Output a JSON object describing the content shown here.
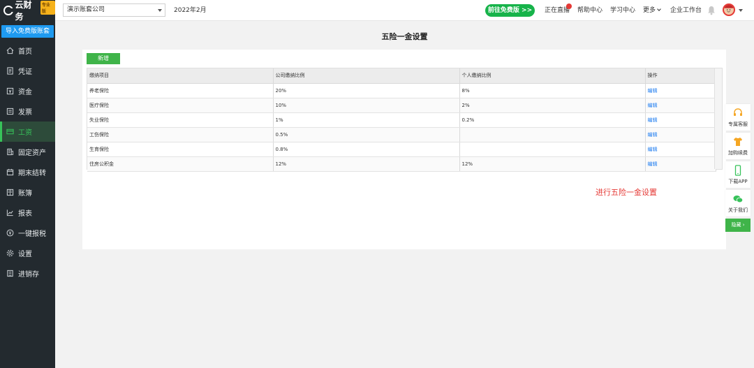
{
  "sidebar": {
    "logo_text": "云财务",
    "logo_badge": "专业版",
    "import_button": "导入免费版账套",
    "items": [
      {
        "label": "首页",
        "icon": "home-icon"
      },
      {
        "label": "凭证",
        "icon": "voucher-icon"
      },
      {
        "label": "资金",
        "icon": "fund-icon"
      },
      {
        "label": "发票",
        "icon": "invoice-icon"
      },
      {
        "label": "工资",
        "icon": "salary-icon",
        "active": true
      },
      {
        "label": "固定资产",
        "icon": "building-icon"
      },
      {
        "label": "期末结转",
        "icon": "calendar-icon"
      },
      {
        "label": "账簿",
        "icon": "ledger-icon"
      },
      {
        "label": "报表",
        "icon": "chart-icon"
      },
      {
        "label": "一键报税",
        "icon": "tax-icon"
      },
      {
        "label": "设置",
        "icon": "gear-icon"
      },
      {
        "label": "进销存",
        "icon": "inventory-icon"
      }
    ]
  },
  "topbar": {
    "company": "演示账套公司",
    "period": "2022年2月",
    "free_button": "前往免费版 >>",
    "links": {
      "live": "正在直播",
      "help": "帮助中心",
      "learn": "学习中心",
      "more": "更多",
      "workbench": "企业工作台"
    }
  },
  "page": {
    "title": "五险一金设置",
    "add_button": "新增",
    "note": "进行五险一金设置"
  },
  "table": {
    "headers": [
      "缴纳项目",
      "公司缴纳比例",
      "个人缴纳比例",
      "操作"
    ],
    "rows": [
      {
        "item": "养老保险",
        "company": "20%",
        "personal": "8%",
        "action": "编辑"
      },
      {
        "item": "医疗保险",
        "company": "10%",
        "personal": "2%",
        "action": "编辑"
      },
      {
        "item": "失业保险",
        "company": "1%",
        "personal": "0.2%",
        "action": "编辑"
      },
      {
        "item": "工伤保险",
        "company": "0.5%",
        "personal": "",
        "action": "编辑"
      },
      {
        "item": "生育保险",
        "company": "0.8%",
        "personal": "",
        "action": "编辑"
      },
      {
        "item": "住房公积金",
        "company": "12%",
        "personal": "12%",
        "action": "编辑"
      }
    ]
  },
  "floatbar": {
    "service": "专属客服",
    "renew": "加购续费",
    "app": "下载APP",
    "about": "关于我们",
    "hide": "隐藏"
  },
  "colors": {
    "sidebar_bg": "#232a2f",
    "active_green": "#37c25a",
    "accent_blue": "#1e9af0",
    "button_green": "#3fb449",
    "note_red": "#e53935"
  }
}
